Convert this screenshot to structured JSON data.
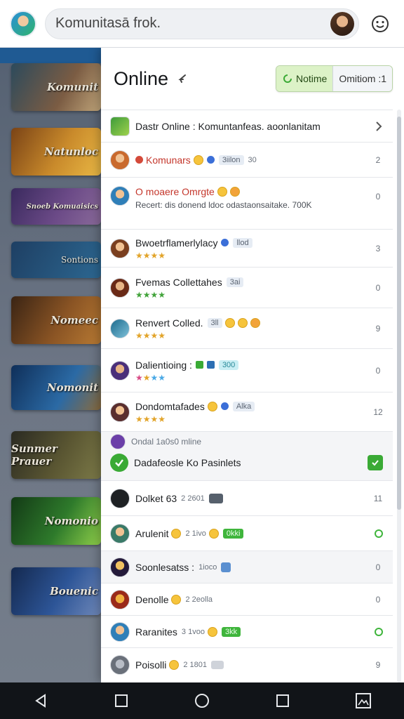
{
  "search": {
    "value": "Komunitasā frok."
  },
  "panel": {
    "title": "Online",
    "toggle": {
      "on_label": "Notime",
      "off_label": "Omitiom :1"
    }
  },
  "rows": [
    {
      "name": "Dastr Online : Komuntanfeas. aoonlanitam",
      "kind": "header"
    },
    {
      "name": "Komunars",
      "tag": "3iilon",
      "plain": "30",
      "count": "2"
    },
    {
      "name": "O moaere Omrgte",
      "sub": "Recert: dis donend ldoc odastaonsaitake. 700K",
      "count": "0"
    },
    {
      "name": "Bwoetrflamerlylacy",
      "tag": "llod",
      "count": "3"
    },
    {
      "name": "Fvemas Collettahes",
      "tag": "3ai",
      "count": "0"
    },
    {
      "name": "Renvert Colled.",
      "tag": "3ll",
      "count": "9"
    },
    {
      "name": "Dalientioing :",
      "tag": "300",
      "count": "0"
    },
    {
      "name": "Dondomtafades",
      "tag": "Alka",
      "count": "12"
    },
    {
      "section": "Ondal 1a0s0 mline",
      "name": "Dadafeosle Ko Pasinlets",
      "kind": "checked"
    },
    {
      "name": "Dolket 63",
      "plain": "2 2601",
      "count": "11"
    },
    {
      "name": "Arulenit",
      "plain": "2 1ivo",
      "tag": "0kki",
      "status": "online"
    },
    {
      "name": "Soonlesatss :",
      "plain": "1ioco",
      "count": "0"
    },
    {
      "name": "Denolle",
      "plain": "2 2eolla",
      "count": "0"
    },
    {
      "name": "Raranites",
      "plain": "3 1voo",
      "tag": "3kk",
      "status": "online"
    },
    {
      "name": "Poisolli",
      "plain": "2 1801",
      "count": "9"
    }
  ],
  "banners": [
    "Komunit",
    "Natunloc",
    "Snoeb Komuaisics",
    "Sontions",
    "Nomeec",
    "Nomonit",
    "Sunmer Prauer",
    "Nomonio",
    "Bouenic"
  ],
  "colors": {
    "accent_green": "#3aaa35",
    "name_red": "#c4362b",
    "header_blue": "#1f5a93"
  }
}
